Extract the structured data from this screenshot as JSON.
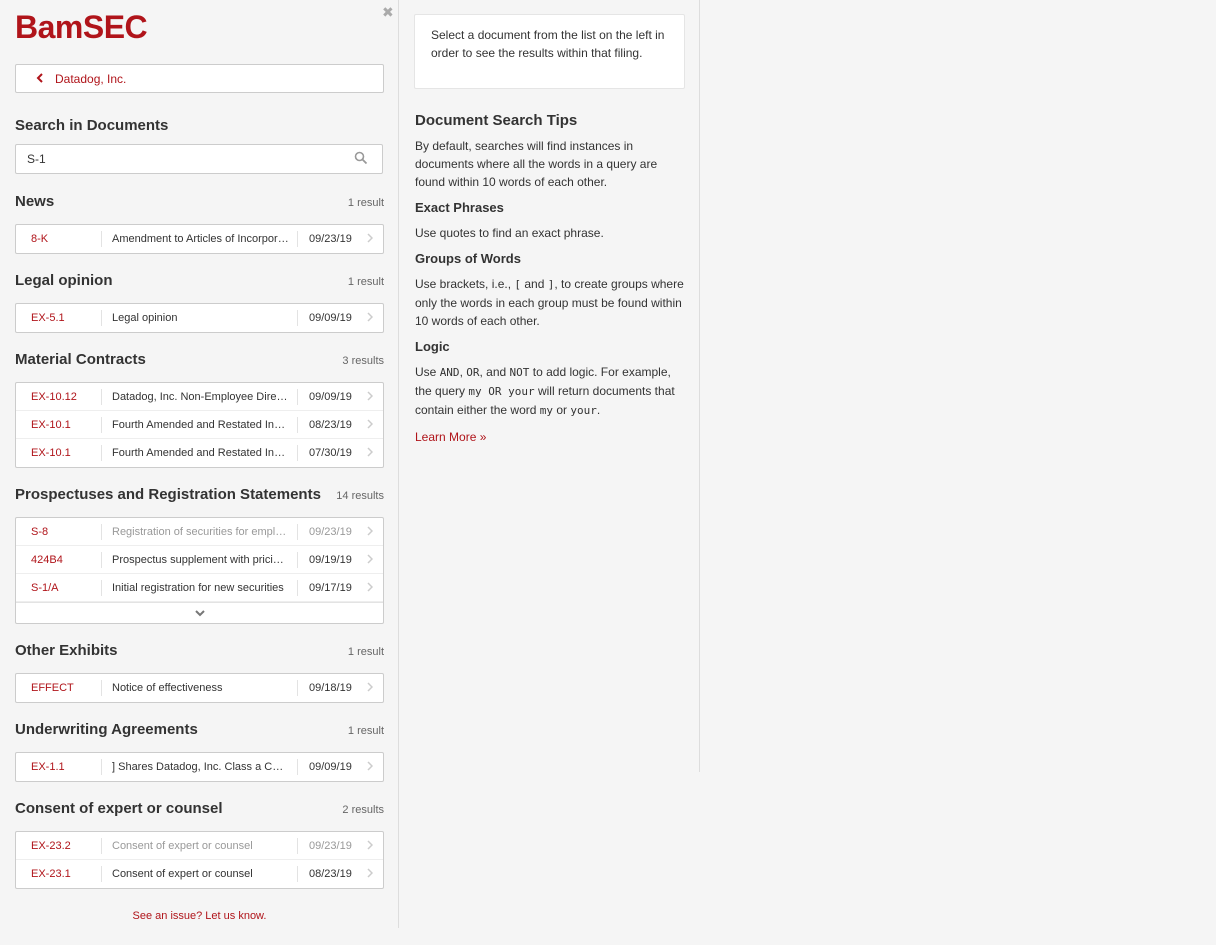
{
  "brand": "BamSEC",
  "close_symbol": "✖",
  "company": {
    "back_icon": "chevron-left-icon",
    "name": "Datadog, Inc."
  },
  "search": {
    "title": "Search in Documents",
    "value": "S-1",
    "icon": "search-icon"
  },
  "sections": [
    {
      "title": "News",
      "count": "1 result",
      "rows": [
        {
          "type": "8-K",
          "desc": "Amendment to Articles of Incorporation",
          "date": "09/23/19",
          "muted": false
        }
      ]
    },
    {
      "title": "Legal opinion",
      "count": "1 result",
      "rows": [
        {
          "type": "EX-5.1",
          "desc": "Legal opinion",
          "date": "09/09/19",
          "muted": false
        }
      ]
    },
    {
      "title": "Material Contracts",
      "count": "3 results",
      "rows": [
        {
          "type": "EX-10.12",
          "desc": "Datadog, Inc. Non-Employee Director Compensation Policy",
          "date": "09/09/19",
          "muted": false
        },
        {
          "type": "EX-10.1",
          "desc": "Fourth Amended and Restated Investors' Rights Agreement",
          "date": "08/23/19",
          "muted": false
        },
        {
          "type": "EX-10.1",
          "desc": "Fourth Amended and Restated Investors' Rights Agreement",
          "date": "07/30/19",
          "muted": false
        }
      ]
    },
    {
      "title": "Prospectuses and Registration Statements",
      "count": "14 results",
      "expand": true,
      "rows": [
        {
          "type": "S-8",
          "desc": "Registration of securities for employees",
          "date": "09/23/19",
          "muted": true
        },
        {
          "type": "424B4",
          "desc": "Prospectus supplement with pricing info",
          "date": "09/19/19",
          "muted": false
        },
        {
          "type": "S-1/A",
          "desc": "Initial registration for new securities",
          "date": "09/17/19",
          "muted": false
        }
      ]
    },
    {
      "title": "Other Exhibits",
      "count": "1 result",
      "rows": [
        {
          "type": "EFFECT",
          "desc": "Notice of effectiveness",
          "date": "09/18/19",
          "muted": false
        }
      ]
    },
    {
      "title": "Underwriting Agreements",
      "count": "1 result",
      "rows": [
        {
          "type": "EX-1.1",
          "desc": "] Shares Datadog, Inc. Class a Common Stock",
          "date": "09/09/19",
          "muted": false
        }
      ]
    },
    {
      "title": "Consent of expert or counsel",
      "count": "2 results",
      "rows": [
        {
          "type": "EX-23.2",
          "desc": "Consent of expert or counsel",
          "date": "09/23/19",
          "muted": true
        },
        {
          "type": "EX-23.1",
          "desc": "Consent of expert or counsel",
          "date": "08/23/19",
          "muted": false
        }
      ]
    }
  ],
  "footer": "See an issue? Let us know.",
  "info": "Select a document from the list on the left in order to see the results within that filing.",
  "tips": {
    "title": "Document Search Tips",
    "intro": "By default, searches will find instances in documents where all the words in a query are found within 10 words of each other.",
    "exact_title": "Exact Phrases",
    "exact_text": "Use quotes to find an exact phrase.",
    "groups_title": "Groups of Words",
    "groups_1": "Use brackets, i.e.,",
    "groups_open": "[",
    "groups_and": "and",
    "groups_close": "]",
    "groups_2": ", to create groups where only the words in each group must be found within 10 words of each other.",
    "logic_title": "Logic",
    "logic_use": "Use",
    "logic_and": "AND",
    "logic_comma": ",",
    "logic_or": "OR",
    "logic_andword": ", and",
    "logic_not": "NOT",
    "logic_2": "to add logic. For example, the query",
    "logic_query": "my OR your",
    "logic_3": "will return documents that contain either the word",
    "logic_my": "my",
    "logic_or_word": "or",
    "logic_your": "your",
    "logic_period": ".",
    "learn_more": "Learn More »"
  }
}
